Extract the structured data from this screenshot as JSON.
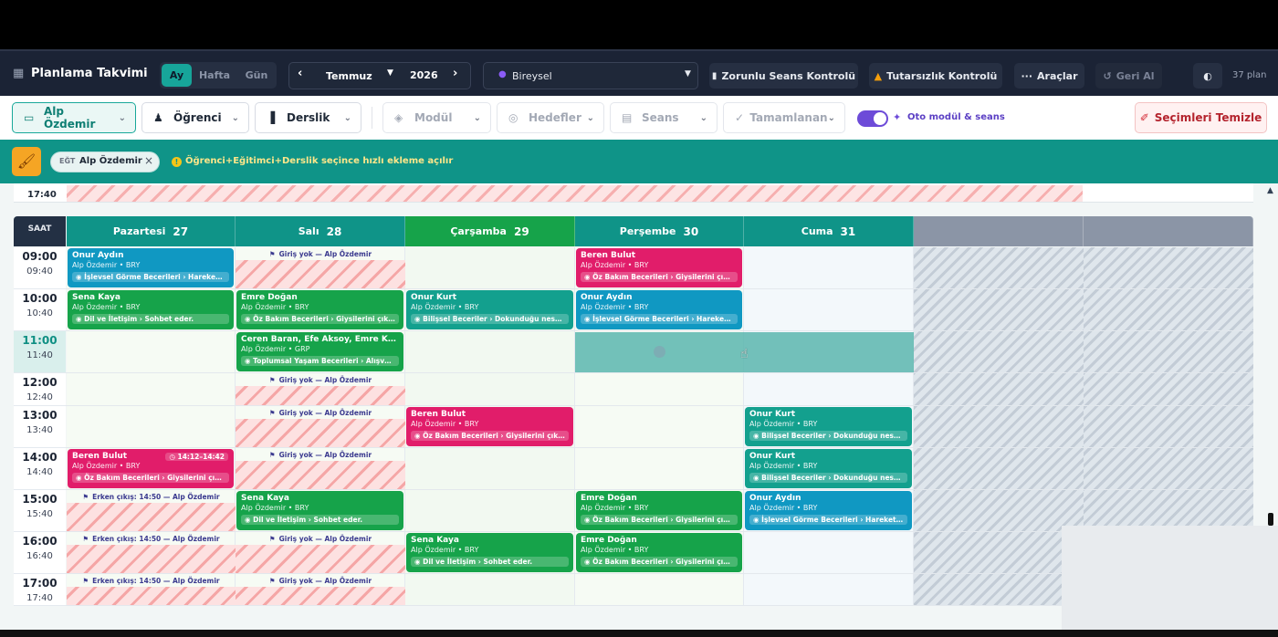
{
  "app": {
    "title": "Planlama Takvimi",
    "plan_count": "37 plan"
  },
  "view_toggle": [
    "Ay",
    "Hafta",
    "Gün"
  ],
  "month_picker": {
    "month": "Temmuz",
    "year": "2026"
  },
  "mode_select": {
    "value": "Bireysel"
  },
  "toolbar": {
    "mandatory": "Zorunlu Seans Kontrolü",
    "inconsistency": "Tutarsızlık Kontrolü",
    "tools": "Araçlar",
    "undo": "Geri Al"
  },
  "filters": {
    "teacher": "Alp Özdemir",
    "student": "Öğrenci",
    "room": "Derslik",
    "module": "Modül",
    "goals": "Hedefler",
    "session": "Seans",
    "completed": "Tamamlanan",
    "auto_label": "Oto modül & seans",
    "clear": "Seçimleri Temizle"
  },
  "teal_bar": {
    "chip_prefix": "EĞT",
    "chip_name": "Alp Özdemir",
    "chip_close": "×",
    "hint": "Öğrenci+Eğitimci+Derslik seçince hızlı ekleme açılır"
  },
  "calendar": {
    "prev_week_last_time": "17:40",
    "hour_col_label": "SAAT",
    "days": [
      {
        "name": "Pazartesi",
        "date": "27"
      },
      {
        "name": "Salı",
        "date": "28"
      },
      {
        "name": "Çarşamba",
        "date": "29"
      },
      {
        "name": "Perşembe",
        "date": "30"
      },
      {
        "name": "Cuma",
        "date": "31"
      }
    ],
    "times": [
      {
        "h": "09:00",
        "m": "09:40"
      },
      {
        "h": "10:00",
        "m": "10:40"
      },
      {
        "h": "11:00",
        "m": "11:40"
      },
      {
        "h": "12:00",
        "m": "12:40"
      },
      {
        "h": "13:00",
        "m": "13:40"
      },
      {
        "h": "14:00",
        "m": "14:40"
      },
      {
        "h": "15:00",
        "m": "15:40"
      },
      {
        "h": "16:00",
        "m": "16:40"
      },
      {
        "h": "17:00",
        "m": "17:40"
      }
    ],
    "events": [
      {
        "day": 0,
        "slot": 0,
        "color": "blue",
        "name": "Onur Aydın",
        "sub": "Alp Özdemir • BRY",
        "goal": "İşlevsel Görme Becerileri › Hareketli n..."
      },
      {
        "day": 3,
        "slot": 0,
        "color": "pink",
        "name": "Beren Bulut",
        "sub": "Alp Özdemir • BRY",
        "goal": "Öz Bakım Becerileri › Giysilerini çıkarır."
      },
      {
        "day": 0,
        "slot": 1,
        "color": "green",
        "name": "Sena Kaya",
        "sub": "Alp Özdemir • BRY",
        "goal": "Dil ve İletişim › Sohbet eder."
      },
      {
        "day": 1,
        "slot": 1,
        "color": "green",
        "name": "Emre Doğan",
        "sub": "Alp Özdemir • BRY",
        "goal": "Öz Bakım Becerileri › Giysilerini çıkarır."
      },
      {
        "day": 2,
        "slot": 1,
        "color": "teal",
        "name": "Onur Kurt",
        "sub": "Alp Özdemir • BRY",
        "goal": "Bilişsel Beceriler › Dokunduğu nesnele..."
      },
      {
        "day": 3,
        "slot": 1,
        "color": "blue",
        "name": "Onur Aydın",
        "sub": "Alp Özdemir • BRY",
        "goal": "İşlevsel Görme Becerileri › Hareketli n..."
      },
      {
        "day": 1,
        "slot": 2,
        "color": "green",
        "name": "Ceren Baran, Efe Aksoy, Emre Kar...",
        "sub": "Alp Özdemir • GRP",
        "goal": "Toplumsal Yaşam Becerileri › Alışveriş ..."
      },
      {
        "day": 2,
        "slot": 4,
        "color": "pink",
        "name": "Beren Bulut",
        "sub": "Alp Özdemir • BRY",
        "goal": "Öz Bakım Becerileri › Giysilerini çıkarır."
      },
      {
        "day": 4,
        "slot": 4,
        "color": "teal",
        "name": "Onur Kurt",
        "sub": "Alp Özdemir • BRY",
        "goal": "Bilişsel Beceriler › Dokunduğu nesnele..."
      },
      {
        "day": 0,
        "slot": 5,
        "color": "pink",
        "name": "Beren Bulut",
        "sub": "Alp Özdemir • BRY",
        "goal": "Öz Bakım Becerileri › Giysilerini çıkarır.",
        "badge": "14:12–14:42"
      },
      {
        "day": 4,
        "slot": 5,
        "color": "teal",
        "name": "Onur Kurt",
        "sub": "Alp Özdemir • BRY",
        "goal": "Bilişsel Beceriler › Dokunduğu nesnele..."
      },
      {
        "day": 1,
        "slot": 6,
        "color": "green",
        "name": "Sena Kaya",
        "sub": "Alp Özdemir • BRY",
        "goal": "Dil ve İletişim › Sohbet eder."
      },
      {
        "day": 3,
        "slot": 6,
        "color": "green",
        "name": "Emre Doğan",
        "sub": "Alp Özdemir • BRY",
        "goal": "Öz Bakım Becerileri › Giysilerini çıkarır."
      },
      {
        "day": 4,
        "slot": 6,
        "color": "blue",
        "name": "Onur Aydın",
        "sub": "Alp Özdemir • BRY",
        "goal": "İşlevsel Görme Becerileri › Hareketli n..."
      },
      {
        "day": 2,
        "slot": 7,
        "color": "green",
        "name": "Sena Kaya",
        "sub": "Alp Özdemir • BRY",
        "goal": "Dil ve İletişim › Sohbet eder."
      },
      {
        "day": 3,
        "slot": 7,
        "color": "green",
        "name": "Emre Doğan",
        "sub": "Alp Özdemir • BRY",
        "goal": "Öz Bakım Becerileri › Giysilerini çıkarır."
      }
    ],
    "notes": [
      {
        "day": 1,
        "slot": 0,
        "text": "Giriş yok — Alp Özdemir"
      },
      {
        "day": 1,
        "slot": 3,
        "text": "Giriş yok — Alp Özdemir"
      },
      {
        "day": 1,
        "slot": 4,
        "text": "Giriş yok — Alp Özdemir"
      },
      {
        "day": 1,
        "slot": 5,
        "text": "Giriş yok — Alp Özdemir"
      },
      {
        "day": 0,
        "slot": 6,
        "text": "Erken çıkış: 14:50 — Alp Özdemir"
      },
      {
        "day": 0,
        "slot": 7,
        "text": "Erken çıkış: 14:50 — Alp Özdemir"
      },
      {
        "day": 1,
        "slot": 7,
        "text": "Giriş yok — Alp Özdemir"
      },
      {
        "day": 0,
        "slot": 8,
        "text": "Erken çıkış: 14:50 — Alp Özdemir"
      },
      {
        "day": 1,
        "slot": 8,
        "text": "Giriş yok — Alp Özdemir"
      }
    ]
  },
  "colors": {
    "teal": "#13a08e",
    "green": "#16a34a",
    "pink": "#e11d6a",
    "blue": "#1098c2",
    "header_bar": "#0f9488"
  }
}
